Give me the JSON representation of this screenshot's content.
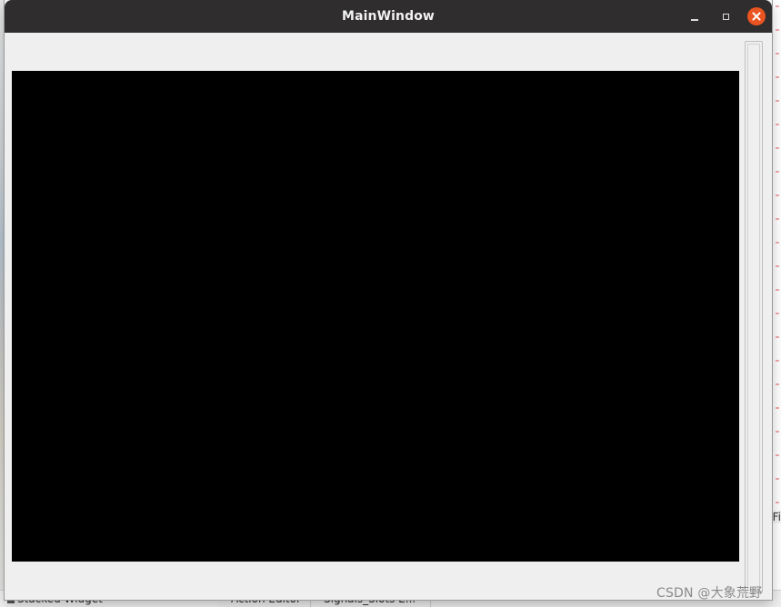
{
  "window": {
    "title": "MainWindow",
    "controls": [
      "minimize",
      "maximize",
      "close"
    ]
  },
  "background": {
    "right_panel_label": "Fi",
    "bottom_left_label": "Stacked Widget",
    "bottom_tabs": [
      "Action Editor",
      "Signals_Slots E..."
    ]
  },
  "watermark": {
    "text": "CSDN @大象荒野"
  },
  "colors": {
    "titlebar": "#2f2d2d",
    "close_button": "#e95420",
    "window_bg": "#efefef",
    "video_bg": "#000000"
  },
  "icons": {
    "minimize": "minimize-icon",
    "maximize": "maximize-icon",
    "close": "close-icon"
  }
}
